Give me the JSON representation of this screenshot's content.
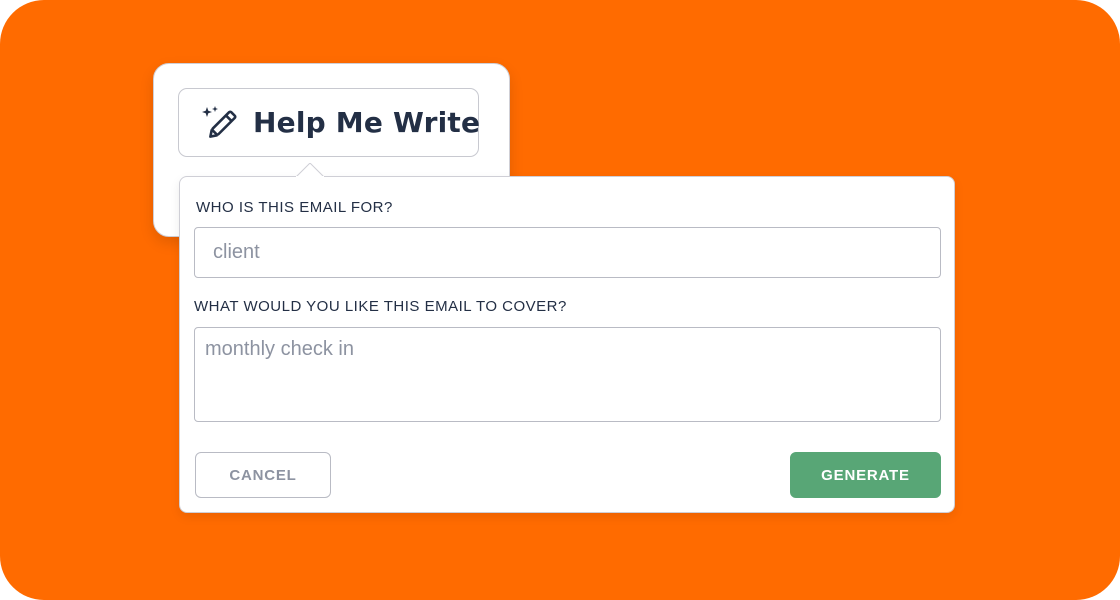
{
  "trigger": {
    "label": "Help Me Write",
    "icon": "magic-wand-icon"
  },
  "form": {
    "recipient": {
      "label": "WHO IS THIS EMAIL FOR?",
      "placeholder": "client"
    },
    "topic": {
      "label": "WHAT WOULD YOU LIKE THIS EMAIL TO COVER?",
      "placeholder": "monthly check in"
    }
  },
  "actions": {
    "cancel_label": "CANCEL",
    "generate_label": "GENERATE"
  },
  "colors": {
    "background": "#ff6b00",
    "primary_button": "#58a676",
    "text_dark": "#232f45",
    "placeholder": "#8d93a1"
  }
}
